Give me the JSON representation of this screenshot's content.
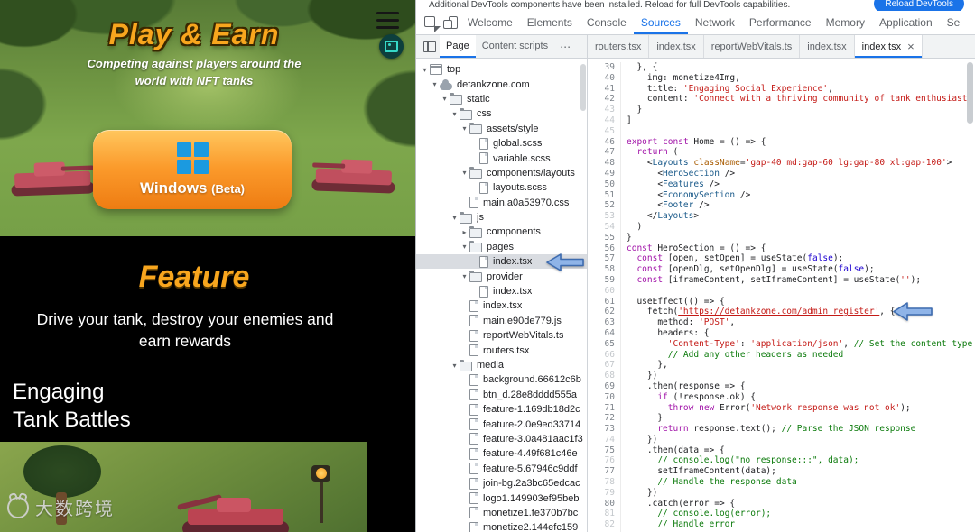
{
  "site": {
    "hero": {
      "title": "Play & Earn",
      "subtitle": "Competing against players around the world with NFT tanks",
      "button_label": "Windows",
      "button_suffix": "(Beta)"
    },
    "feature": {
      "heading": "Feature",
      "description": "Drive your tank, destroy your enemies and earn rewards",
      "card_line1": "Engaging",
      "card_line2": "Tank Battles"
    },
    "watermark": "大数跨境"
  },
  "devtools": {
    "notification": {
      "message": "Additional DevTools components have been installed. Reload for full DevTools capabilities.",
      "button_label": "Reload DevTools"
    },
    "main_tabs": [
      {
        "label": "Welcome"
      },
      {
        "label": "Elements"
      },
      {
        "label": "Console"
      },
      {
        "label": "Sources",
        "active": true
      },
      {
        "label": "Network"
      },
      {
        "label": "Performance"
      },
      {
        "label": "Memory"
      },
      {
        "label": "Application"
      },
      {
        "label": "Se"
      }
    ],
    "navigator_tabs": [
      {
        "label": "Page",
        "active": true
      },
      {
        "label": "Content scripts"
      }
    ],
    "navigator_more": "⋯",
    "file_tabs": [
      {
        "label": "routers.tsx"
      },
      {
        "label": "index.tsx"
      },
      {
        "label": "reportWebVitals.ts"
      },
      {
        "label": "index.tsx"
      },
      {
        "label": "index.tsx",
        "active": true,
        "closable": true
      }
    ],
    "file_tree": [
      {
        "label": "top",
        "type": "frame",
        "depth": 0,
        "exp": true
      },
      {
        "label": "detankzone.com",
        "type": "cloud",
        "depth": 1,
        "exp": true
      },
      {
        "label": "static",
        "type": "folder",
        "depth": 2,
        "exp": true
      },
      {
        "label": "css",
        "type": "folder",
        "depth": 3,
        "exp": true
      },
      {
        "label": "assets/style",
        "type": "folder",
        "depth": 4,
        "exp": true
      },
      {
        "label": "global.scss",
        "type": "file",
        "depth": 5
      },
      {
        "label": "variable.scss",
        "type": "file",
        "depth": 5
      },
      {
        "label": "components/layouts",
        "type": "folder",
        "depth": 4,
        "exp": true
      },
      {
        "label": "layouts.scss",
        "type": "file",
        "depth": 5
      },
      {
        "label": "main.a0a53970.css",
        "type": "file",
        "depth": 4
      },
      {
        "label": "js",
        "type": "folder",
        "depth": 3,
        "exp": true
      },
      {
        "label": "components",
        "type": "folder",
        "depth": 4,
        "exp": false
      },
      {
        "label": "pages",
        "type": "folder",
        "depth": 4,
        "exp": true
      },
      {
        "label": "index.tsx",
        "type": "file",
        "depth": 5,
        "selected": true
      },
      {
        "label": "provider",
        "type": "folder",
        "depth": 4,
        "exp": true
      },
      {
        "label": "index.tsx",
        "type": "file",
        "depth": 5
      },
      {
        "label": "index.tsx",
        "type": "file",
        "depth": 4
      },
      {
        "label": "main.e90de779.js",
        "type": "file",
        "depth": 4
      },
      {
        "label": "reportWebVitals.ts",
        "type": "file",
        "depth": 4
      },
      {
        "label": "routers.tsx",
        "type": "file",
        "depth": 4
      },
      {
        "label": "media",
        "type": "folder",
        "depth": 3,
        "exp": true
      },
      {
        "label": "background.66612c6b",
        "type": "file",
        "depth": 4
      },
      {
        "label": "btn_d.28e8dddd555a",
        "type": "file",
        "depth": 4
      },
      {
        "label": "feature-1.169db18d2c",
        "type": "file",
        "depth": 4
      },
      {
        "label": "feature-2.0e9ed33714",
        "type": "file",
        "depth": 4
      },
      {
        "label": "feature-3.0a481aac1f3",
        "type": "file",
        "depth": 4
      },
      {
        "label": "feature-4.49f681c46e",
        "type": "file",
        "depth": 4
      },
      {
        "label": "feature-5.67946c9ddf",
        "type": "file",
        "depth": 4
      },
      {
        "label": "join-bg.2a3bc65edcac",
        "type": "file",
        "depth": 4
      },
      {
        "label": "logo1.149903ef95beb",
        "type": "file",
        "depth": 4
      },
      {
        "label": "monetize1.fe370b7bc",
        "type": "file",
        "depth": 4
      },
      {
        "label": "monetize2.144efc159",
        "type": "file",
        "depth": 4
      }
    ],
    "code": {
      "lines": [
        {
          "n": 39,
          "x": [
            [
              "pl",
              "  }, {"
            ]
          ]
        },
        {
          "n": 40,
          "x": [
            [
              "pl",
              "    img: monetize4Img,"
            ]
          ]
        },
        {
          "n": 41,
          "x": [
            [
              "pl",
              "    title: "
            ],
            [
              "st",
              "'Engaging Social Experience'"
            ],
            [
              "pl",
              ","
            ]
          ]
        },
        {
          "n": 42,
          "x": [
            [
              "pl",
              "    content: "
            ],
            [
              "st",
              "'Connect with a thriving community of tank enthusiasts"
            ]
          ]
        },
        {
          "n": 43,
          "d": 1,
          "x": [
            [
              "pl",
              "  }"
            ]
          ]
        },
        {
          "n": 44,
          "d": 1,
          "x": [
            [
              "pl",
              "]"
            ]
          ]
        },
        {
          "n": 45,
          "d": 1,
          "x": []
        },
        {
          "n": 46,
          "x": [
            [
              "kw",
              "export"
            ],
            [
              "pl",
              " "
            ],
            [
              "kw",
              "const"
            ],
            [
              "pl",
              " Home = () => {"
            ]
          ]
        },
        {
          "n": 47,
          "x": [
            [
              "pl",
              "  "
            ],
            [
              "kw",
              "return"
            ],
            [
              "pl",
              " ("
            ]
          ]
        },
        {
          "n": 48,
          "x": [
            [
              "pl",
              "    <"
            ],
            [
              "tg",
              "Layouts"
            ],
            [
              "pl",
              " "
            ],
            [
              "ab",
              "className"
            ],
            [
              "pl",
              "="
            ],
            [
              "st",
              "'gap-40 md:gap-60 lg:gap-80 xl:gap-100'"
            ],
            [
              "pl",
              ">"
            ]
          ]
        },
        {
          "n": 49,
          "x": [
            [
              "pl",
              "      <"
            ],
            [
              "tg",
              "HeroSection"
            ],
            [
              "pl",
              " />"
            ]
          ]
        },
        {
          "n": 50,
          "x": [
            [
              "pl",
              "      <"
            ],
            [
              "tg",
              "Features"
            ],
            [
              "pl",
              " />"
            ]
          ]
        },
        {
          "n": 51,
          "x": [
            [
              "pl",
              "      <"
            ],
            [
              "tg",
              "EconomySection"
            ],
            [
              "pl",
              " />"
            ]
          ]
        },
        {
          "n": 52,
          "x": [
            [
              "pl",
              "      <"
            ],
            [
              "tg",
              "Footer"
            ],
            [
              "pl",
              " />"
            ]
          ]
        },
        {
          "n": 53,
          "d": 1,
          "x": [
            [
              "pl",
              "    </"
            ],
            [
              "tg",
              "Layouts"
            ],
            [
              "pl",
              ">"
            ]
          ]
        },
        {
          "n": 54,
          "d": 1,
          "x": [
            [
              "pl",
              "  )"
            ]
          ]
        },
        {
          "n": 55,
          "x": [
            [
              "pl",
              "}"
            ]
          ]
        },
        {
          "n": 56,
          "x": [
            [
              "kw",
              "const"
            ],
            [
              "pl",
              " HeroSection = () => {"
            ]
          ]
        },
        {
          "n": 57,
          "x": [
            [
              "pl",
              "  "
            ],
            [
              "kw",
              "const"
            ],
            [
              "pl",
              " [open, setOpen] = useState("
            ],
            [
              "at",
              "false"
            ],
            [
              "pl",
              ");"
            ]
          ]
        },
        {
          "n": 58,
          "x": [
            [
              "pl",
              "  "
            ],
            [
              "kw",
              "const"
            ],
            [
              "pl",
              " [openDlg, setOpenDlg] = useState("
            ],
            [
              "at",
              "false"
            ],
            [
              "pl",
              ");"
            ]
          ]
        },
        {
          "n": 59,
          "x": [
            [
              "pl",
              "  "
            ],
            [
              "kw",
              "const"
            ],
            [
              "pl",
              " [iframeContent, setIframeContent] = useState("
            ],
            [
              "st",
              "''"
            ],
            [
              "pl",
              ");"
            ]
          ]
        },
        {
          "n": 60,
          "d": 1,
          "x": []
        },
        {
          "n": 61,
          "x": [
            [
              "pl",
              "  useEffect(() => {"
            ]
          ]
        },
        {
          "n": 62,
          "x": [
            [
              "pl",
              "    fetch("
            ],
            [
              "lk",
              "'https://detankzone.com/admin_register'"
            ],
            [
              "pl",
              ", {"
            ]
          ]
        },
        {
          "n": 63,
          "x": [
            [
              "pl",
              "      method: "
            ],
            [
              "st",
              "'POST'"
            ],
            [
              "pl",
              ","
            ]
          ]
        },
        {
          "n": 64,
          "x": [
            [
              "pl",
              "      headers: {"
            ]
          ]
        },
        {
          "n": 65,
          "x": [
            [
              "pl",
              "        "
            ],
            [
              "st",
              "'Content-Type'"
            ],
            [
              "pl",
              ": "
            ],
            [
              "st",
              "'application/json'"
            ],
            [
              "pl",
              ", "
            ],
            [
              "cm",
              "// Set the content type"
            ]
          ]
        },
        {
          "n": 66,
          "d": 1,
          "x": [
            [
              "pl",
              "        "
            ],
            [
              "cm",
              "// Add any other headers as needed"
            ]
          ]
        },
        {
          "n": 67,
          "d": 1,
          "x": [
            [
              "pl",
              "      },"
            ]
          ]
        },
        {
          "n": 68,
          "d": 1,
          "x": [
            [
              "pl",
              "    })"
            ]
          ]
        },
        {
          "n": 69,
          "x": [
            [
              "pl",
              "    .then(response => {"
            ]
          ]
        },
        {
          "n": 70,
          "x": [
            [
              "pl",
              "      "
            ],
            [
              "kw",
              "if"
            ],
            [
              "pl",
              " (!response.ok) {"
            ]
          ]
        },
        {
          "n": 71,
          "x": [
            [
              "pl",
              "        "
            ],
            [
              "kw",
              "throw"
            ],
            [
              "pl",
              " "
            ],
            [
              "kw",
              "new"
            ],
            [
              "pl",
              " Error("
            ],
            [
              "st",
              "'Network response was not ok'"
            ],
            [
              "pl",
              ");"
            ]
          ]
        },
        {
          "n": 72,
          "x": [
            [
              "pl",
              "      }"
            ]
          ]
        },
        {
          "n": 73,
          "x": [
            [
              "pl",
              "      "
            ],
            [
              "kw",
              "return"
            ],
            [
              "pl",
              " response.text(); "
            ],
            [
              "cm",
              "// Parse the JSON response"
            ]
          ]
        },
        {
          "n": 74,
          "d": 1,
          "x": [
            [
              "pl",
              "    })"
            ]
          ]
        },
        {
          "n": 75,
          "x": [
            [
              "pl",
              "    .then(data => {"
            ]
          ]
        },
        {
          "n": 76,
          "d": 1,
          "x": [
            [
              "pl",
              "      "
            ],
            [
              "cm",
              "// console.log(\"no response:::\", data);"
            ]
          ]
        },
        {
          "n": 77,
          "x": [
            [
              "pl",
              "      setIframeContent(data);"
            ]
          ]
        },
        {
          "n": 78,
          "d": 1,
          "x": [
            [
              "pl",
              "      "
            ],
            [
              "cm",
              "// Handle the response data"
            ]
          ]
        },
        {
          "n": 79,
          "d": 1,
          "x": [
            [
              "pl",
              "    })"
            ]
          ]
        },
        {
          "n": 80,
          "x": [
            [
              "pl",
              "    .catch(error => {"
            ]
          ]
        },
        {
          "n": 81,
          "d": 1,
          "x": [
            [
              "pl",
              "      "
            ],
            [
              "cm",
              "// console.log(error);"
            ]
          ]
        },
        {
          "n": 82,
          "d": 1,
          "x": [
            [
              "pl",
              "      "
            ],
            [
              "cm",
              "// Handle error"
            ]
          ]
        }
      ]
    }
  }
}
